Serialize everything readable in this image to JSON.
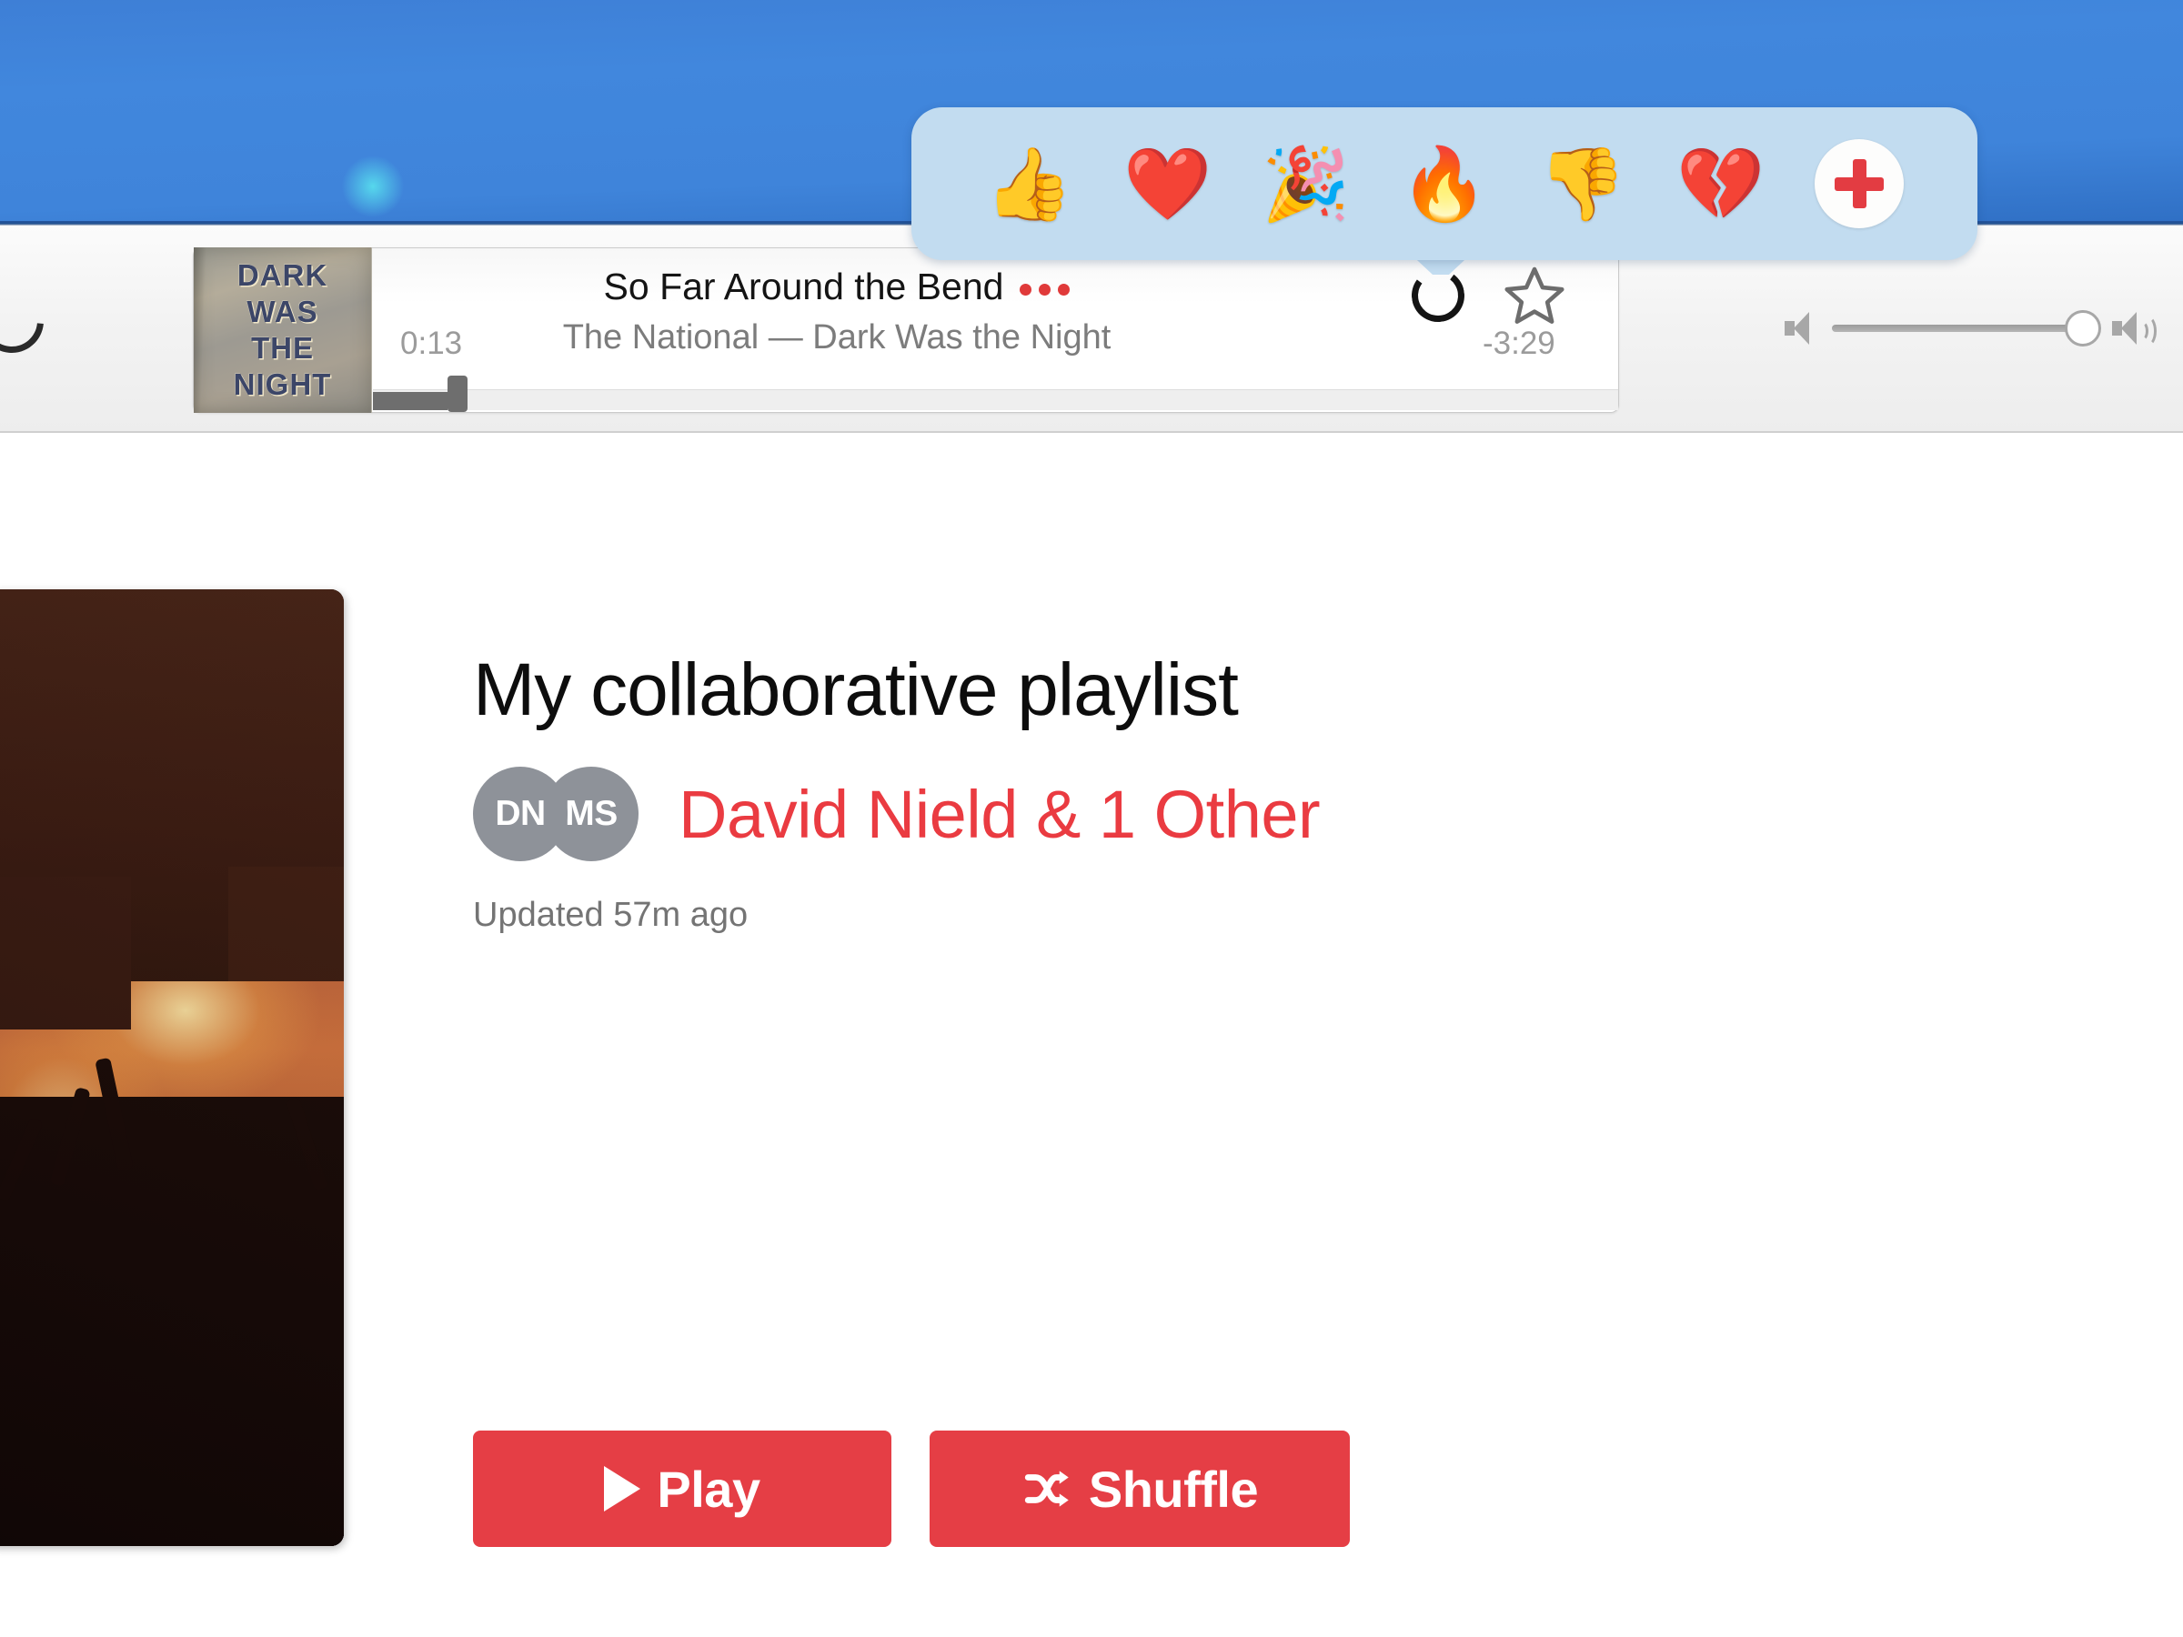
{
  "desktop": {
    "name": "desktop-background"
  },
  "reaction_popover": {
    "name": "emoji-reaction-popover",
    "emojis": [
      {
        "name": "thumbs-up-icon",
        "glyph": "👍"
      },
      {
        "name": "red-heart-icon",
        "glyph": "❤️"
      },
      {
        "name": "party-popper-icon",
        "glyph": "🎉"
      },
      {
        "name": "fire-icon",
        "glyph": "🔥"
      },
      {
        "name": "thumbs-down-icon",
        "glyph": "👎"
      },
      {
        "name": "broken-heart-icon",
        "glyph": "💔"
      }
    ],
    "add_label": "+"
  },
  "player": {
    "album_art_lines": [
      "DARK",
      "WAS",
      "THE",
      "NIGHT"
    ],
    "track_title": "So Far Around the Bend",
    "track_subtitle": "The National — Dark Was the Night",
    "time_elapsed": "0:13",
    "time_remaining": "-3:29",
    "progress_percent": 6,
    "more_options_label": "•••",
    "reaction_button_label": "reaction",
    "favorite_button_label": "star"
  },
  "volume": {
    "level_percent": 100,
    "low_icon": "volume-low-icon",
    "high_icon": "volume-high-icon"
  },
  "playlist": {
    "title": "My collaborative playlist",
    "avatars": [
      {
        "initials": "DN"
      },
      {
        "initials": "MS"
      }
    ],
    "owners": "David Nield & 1 Other",
    "updated": "Updated 57m ago",
    "cover_alt": "concert-photo"
  },
  "actions": {
    "play_label": "Play",
    "shuffle_label": "Shuffle"
  },
  "colors": {
    "accent_red": "#e53e45",
    "owner_red": "#ea3b41",
    "popover_blue": "#c2dcf0",
    "desktop_blue": "#4187dd",
    "avatar_gray": "#8e9299"
  }
}
